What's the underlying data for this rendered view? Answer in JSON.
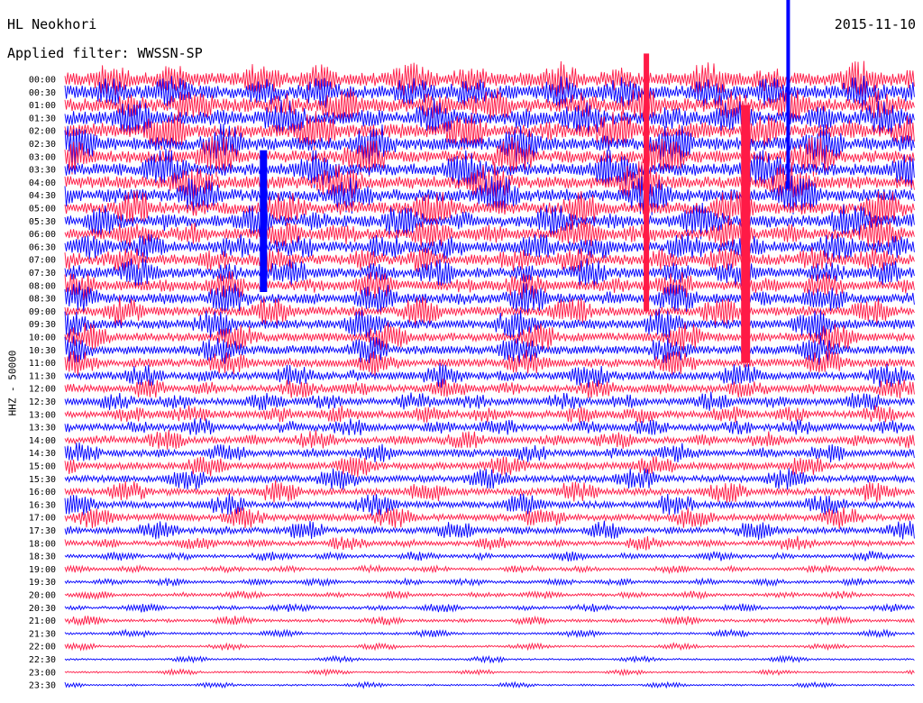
{
  "header": {
    "station": "HL Neokhori",
    "date": "2015-11-10",
    "filter": "Applied filter: WWSSN-SP"
  },
  "channel_label": "HHZ - 50000",
  "colors": {
    "trace_a": "#ff1a46",
    "trace_b": "#0000ff",
    "background": "#ffffff",
    "text": "#000000"
  },
  "chart_data": {
    "type": "line",
    "title": "HL Neokhori",
    "subtitle": "Applied filter: WWSSN-SP",
    "ylabel": "HHZ - 50000",
    "date": "2015-11-10",
    "row_interval_minutes": 30,
    "series_colors": [
      "#ff1a46",
      "#0000ff"
    ],
    "row_labels": [
      "00:00",
      "00:30",
      "01:00",
      "01:30",
      "02:00",
      "02:30",
      "03:00",
      "03:30",
      "04:00",
      "04:30",
      "05:00",
      "05:30",
      "06:00",
      "06:30",
      "07:00",
      "07:30",
      "08:00",
      "08:30",
      "09:00",
      "09:30",
      "10:00",
      "10:30",
      "11:00",
      "11:30",
      "12:00",
      "12:30",
      "13:00",
      "13:30",
      "14:00",
      "14:30",
      "15:00",
      "15:30",
      "16:00",
      "16:30",
      "17:00",
      "17:30",
      "18:00",
      "18:30",
      "19:00",
      "19:30",
      "20:00",
      "20:30",
      "21:00",
      "21:30",
      "22:00",
      "22:30",
      "23:00",
      "23:30"
    ],
    "row_activity": [
      1.0,
      1.0,
      1.0,
      0.95,
      0.95,
      0.95,
      0.9,
      0.9,
      0.9,
      0.9,
      0.85,
      0.85,
      0.8,
      0.8,
      0.75,
      0.75,
      0.7,
      0.7,
      0.65,
      0.65,
      0.6,
      0.6,
      0.55,
      0.55,
      0.5,
      0.5,
      0.5,
      0.45,
      0.45,
      0.45,
      0.45,
      0.45,
      0.45,
      0.45,
      0.45,
      0.4,
      0.3,
      0.2,
      0.15,
      0.15,
      0.15,
      0.15,
      0.15,
      0.1,
      0.08,
      0.06,
      0.05,
      0.05
    ],
    "events": [
      {
        "row": 1,
        "minute": 25.5,
        "amplitude": 7.5
      },
      {
        "row": 8,
        "minute": 20.5,
        "amplitude": 10.0
      },
      {
        "row": 11,
        "minute": 7.0,
        "amplitude": 5.5
      },
      {
        "row": 12,
        "minute": 24.0,
        "amplitude": 10.0
      }
    ]
  }
}
